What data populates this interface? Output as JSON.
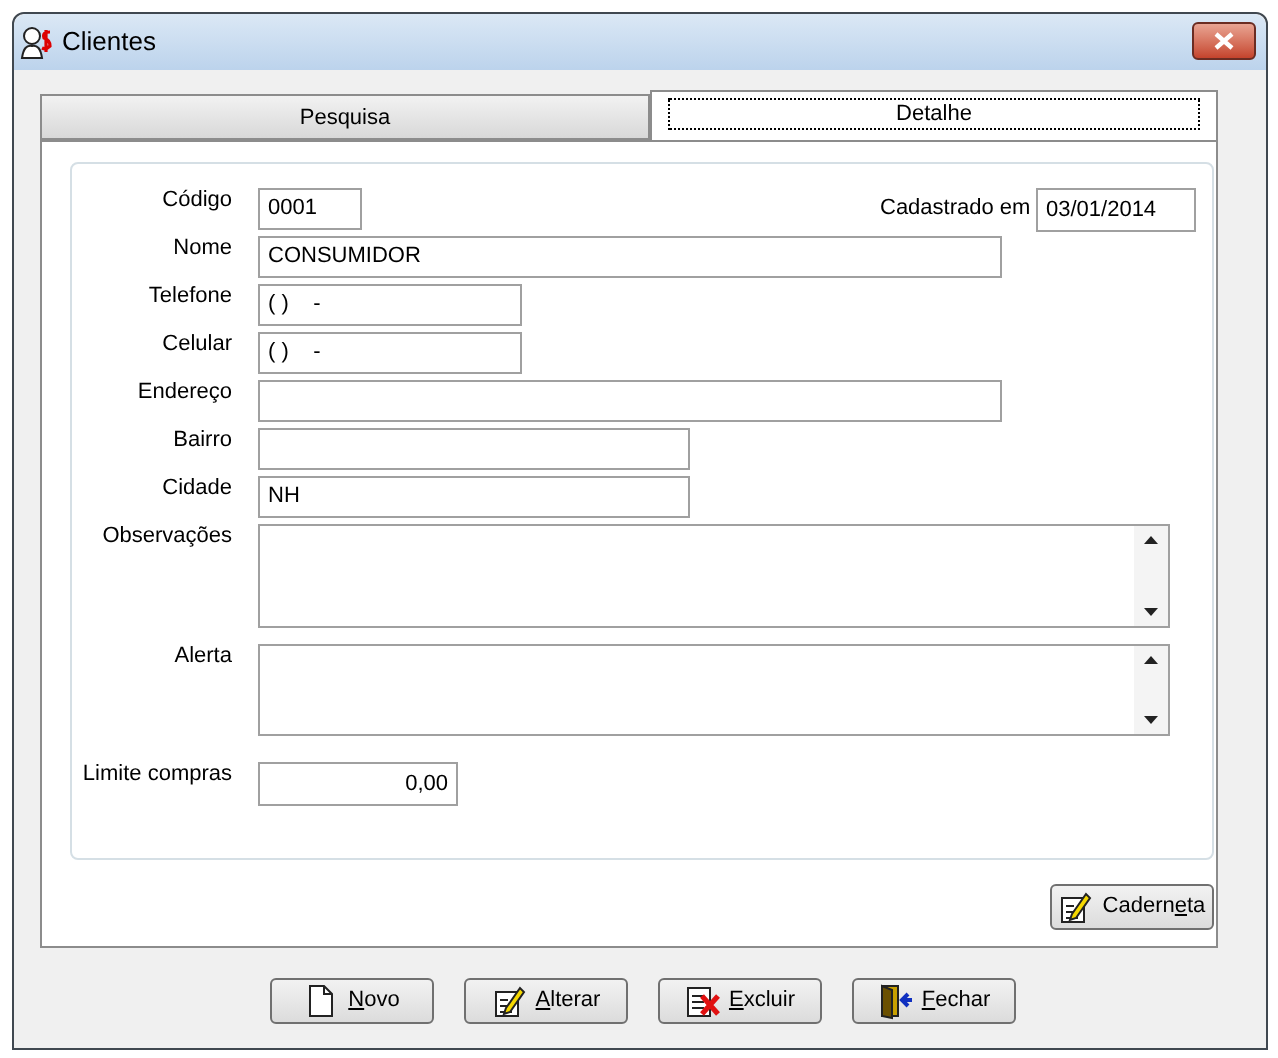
{
  "window": {
    "title": "Clientes"
  },
  "tabs": [
    {
      "label": "Pesquisa",
      "selected": false
    },
    {
      "label": "Detalhe",
      "selected": true
    }
  ],
  "registered": {
    "label": "Cadastrado em",
    "value": "03/01/2014"
  },
  "fields": [
    {
      "label": "Código",
      "value": "0001",
      "kind": "text"
    },
    {
      "label": "Nome",
      "value": "CONSUMIDOR",
      "kind": "text"
    },
    {
      "label": "Telefone",
      "value": "( )    -",
      "kind": "text"
    },
    {
      "label": "Celular",
      "value": "( )    -",
      "kind": "text"
    },
    {
      "label": "Endereço",
      "kind": "text"
    },
    {
      "label": "Bairro",
      "kind": "text"
    },
    {
      "label": "Cidade",
      "value": "NH",
      "kind": "text"
    },
    {
      "label": "Observações",
      "kind": "memo"
    },
    {
      "label": "Alerta",
      "kind": "memo"
    },
    {
      "label": "Limite compras",
      "value": "0,00",
      "kind": "number"
    }
  ],
  "side_button": {
    "before": "Cadern",
    "key": "e",
    "after": "ta",
    "kind": "edit"
  },
  "buttons": [
    {
      "key": "N",
      "after": "ovo",
      "kind": "new"
    },
    {
      "key": "A",
      "after": "lterar",
      "kind": "edit"
    },
    {
      "key": "E",
      "after": "xcluir",
      "kind": "delete"
    },
    {
      "key": "F",
      "after": "echar",
      "kind": "exit"
    }
  ]
}
